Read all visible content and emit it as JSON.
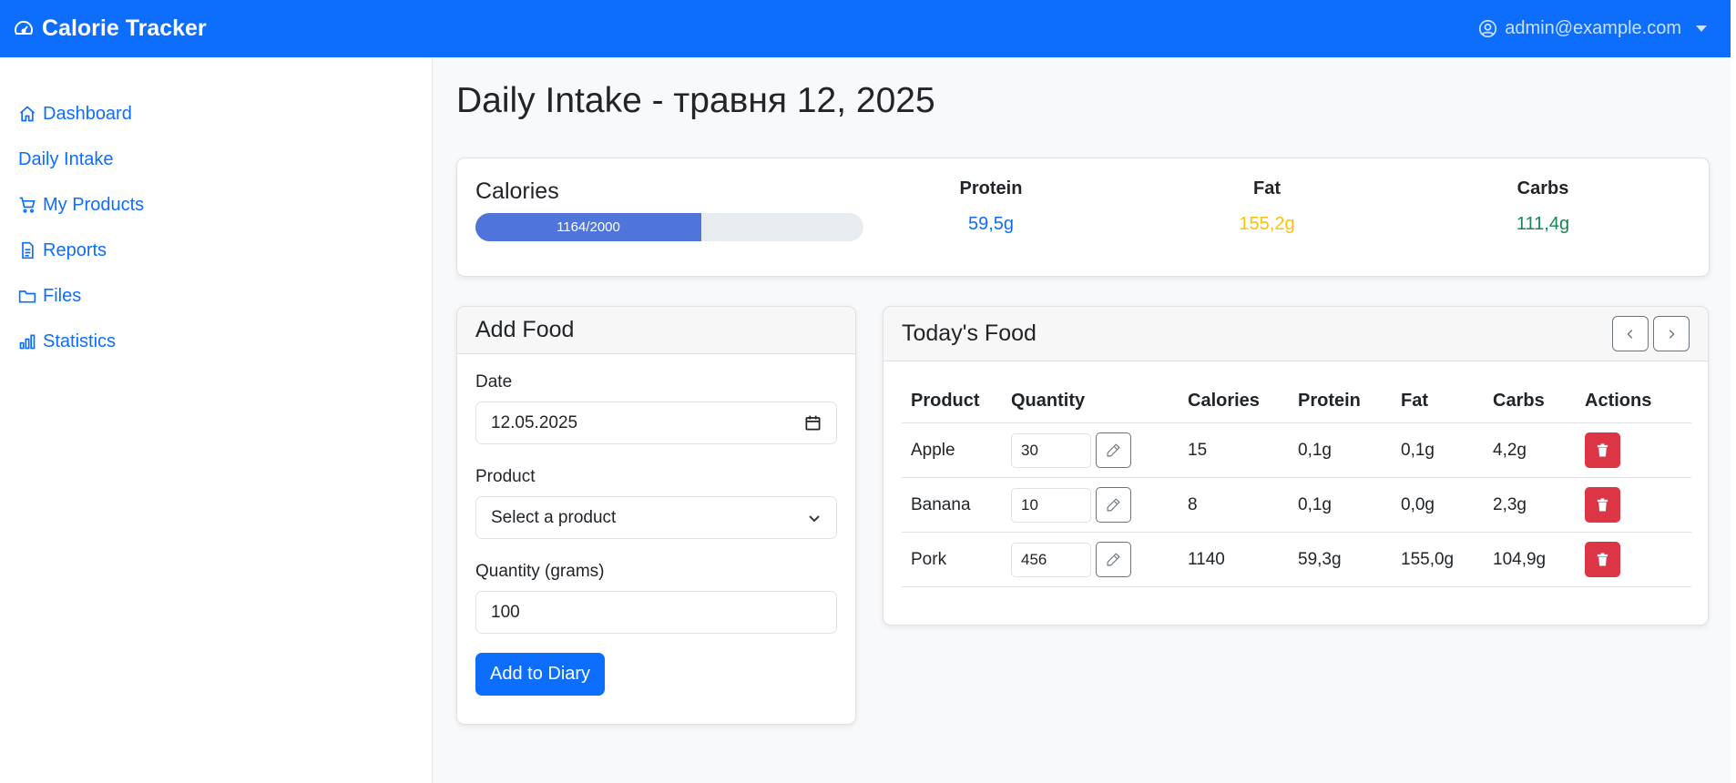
{
  "navbar": {
    "brand": "Calorie Tracker",
    "brand_icon": "speedometer-icon",
    "user_email": "admin@example.com",
    "user_icon": "person-circle-icon"
  },
  "sidebar": {
    "items": [
      {
        "label": "Dashboard",
        "icon": "house-icon"
      },
      {
        "label": "Daily Intake",
        "icon": ""
      },
      {
        "label": "My Products",
        "icon": "cart-icon"
      },
      {
        "label": "Reports",
        "icon": "file-text-icon"
      },
      {
        "label": "Files",
        "icon": "folder-icon"
      },
      {
        "label": "Statistics",
        "icon": "bar-chart-icon"
      }
    ]
  },
  "page": {
    "title": "Daily Intake - травня 12, 2025"
  },
  "summary": {
    "calories_label": "Calories",
    "calories_text": "1164/2000",
    "calories_consumed": 1164,
    "calories_goal": 2000,
    "protein": {
      "label": "Protein",
      "value": "59,5g",
      "color": "#0d6efd"
    },
    "fat": {
      "label": "Fat",
      "value": "155,2g",
      "color": "#ffc107"
    },
    "carbs": {
      "label": "Carbs",
      "value": "111,4g",
      "color": "#198754"
    }
  },
  "add_food": {
    "title": "Add Food",
    "date_label": "Date",
    "date_value": "12.05.2025",
    "product_label": "Product",
    "product_value": "Select a product",
    "quantity_label": "Quantity (grams)",
    "quantity_value": "100",
    "submit_label": "Add to Diary"
  },
  "todays_food": {
    "title": "Today's Food",
    "columns": [
      "Product",
      "Quantity",
      "Calories",
      "Protein",
      "Fat",
      "Carbs",
      "Actions"
    ],
    "rows": [
      {
        "product": "Apple",
        "quantity": "30",
        "calories": "15",
        "protein": "0,1g",
        "fat": "0,1g",
        "carbs": "4,2g"
      },
      {
        "product": "Banana",
        "quantity": "10",
        "calories": "8",
        "protein": "0,1g",
        "fat": "0,0g",
        "carbs": "2,3g"
      },
      {
        "product": "Pork",
        "quantity": "456",
        "calories": "1140",
        "protein": "59,3g",
        "fat": "155,0g",
        "carbs": "104,9g"
      }
    ]
  }
}
